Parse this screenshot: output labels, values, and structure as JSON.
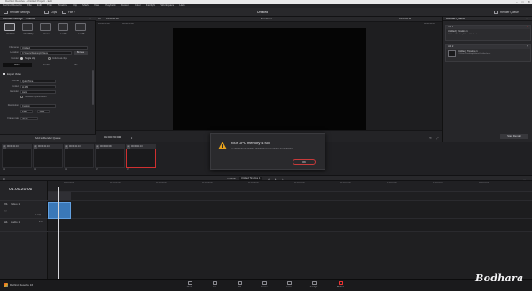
{
  "window": {
    "title": "DaVinci Resolve - Untitled Project - Edit"
  },
  "menu": [
    "DaVinci Resolve",
    "File",
    "Edit",
    "Trim",
    "Timeline",
    "Clip",
    "Mark",
    "View",
    "Playback",
    "Fusion",
    "Color",
    "Fairlight",
    "Workspace",
    "Help"
  ],
  "toolbar": {
    "render_settings": "Render Settings",
    "clips": "Clips",
    "file": "File ▾",
    "project_title": "Untitled",
    "render_queue": "Render Queue"
  },
  "render_settings": {
    "header": "Render Settings - Custom",
    "presets": [
      {
        "label": "Custom"
      },
      {
        "label": "YT 1080p"
      },
      {
        "label": "Vimeo"
      },
      {
        "label": "H.264"
      },
      {
        "label": "H.265"
      }
    ],
    "filename_label": "Filename",
    "filename_value": "Untitled",
    "location_label": "Location",
    "location_value": "C:\\Users\\Desktop\\Videos",
    "browse": "Browse",
    "render_label": "Render",
    "render_single": "Single clip",
    "render_individual": "Individual clips",
    "tabs": [
      "Video",
      "Audio",
      "File"
    ],
    "export_video": "Export Video",
    "format_label": "Format",
    "format_value": "QuickTime",
    "codec_label": "Codec",
    "codec_value": "H.264",
    "encoder_label": "Encoder",
    "encoder_value": "Auto",
    "network_opt": "Network Optimization",
    "resolution_label": "Resolution",
    "resolution_value": "Custom",
    "res_w": "1920",
    "res_h": "1080",
    "framerate_label": "Frame rate",
    "framerate_value": "29.97",
    "add_to_queue": "Add to Render Queue"
  },
  "viewer": {
    "timecode_left": "01:00:00:00",
    "timeline_name": "Timeline 1",
    "zoom": "Fit",
    "in_time": "01:00:00:00",
    "out_time": "01:00:20:08",
    "duration": "00:00:20:09",
    "current_tc": "01:00:20:08"
  },
  "render_queue": {
    "header": "Render Queue",
    "jobs": [
      {
        "id": "Job 1",
        "title": "Untitled | Timeline 1",
        "path": "C:\\Users\\Desktop\\Videos\\Untitled.mov"
      },
      {
        "id": "Job 2",
        "title": "Untitled | Timeline 1",
        "path": "C:\\Users\\Desktop\\Videos\\Untitled.mov"
      }
    ],
    "render_all": "Start Render"
  },
  "clips": [
    {
      "num": "01",
      "tc": "00:00:21:13",
      "label": "V1"
    },
    {
      "num": "02",
      "tc": "00:00:21:13",
      "label": "V1"
    },
    {
      "num": "03",
      "tc": "00:00:21:13",
      "label": "V1"
    },
    {
      "num": "04",
      "tc": "00:00:20:09",
      "label": "V1"
    },
    {
      "num": "05",
      "tc": "00:00:21:13",
      "label": "V1"
    }
  ],
  "modal": {
    "message": "Your GPU memory is full.",
    "detail": "Try reducing the timeline resolution or the number of correctors.",
    "ok": "OK"
  },
  "timeline": {
    "current_tc": "01:00:20:08",
    "timeline_label": "Timeline",
    "timeline_name": "Untitled Timeline 1",
    "video_track": "Video 1",
    "video_track_id": "V1",
    "audio_track": "Audio 1",
    "audio_track_id": "A1",
    "audio_level": "2.0",
    "clip_count": "1 Clip",
    "ruler": [
      "01:00:00:00",
      "01:00:02:00",
      "01:00:04:00",
      "01:00:06:00",
      "01:00:08:00",
      "01:00:10:00",
      "01:00:12:00",
      "01:00:14:00",
      "01:00:16:00",
      "01:00:18:00"
    ]
  },
  "pages": [
    {
      "label": "Media"
    },
    {
      "label": "Cut"
    },
    {
      "label": "Edit"
    },
    {
      "label": "Fusion"
    },
    {
      "label": "Color"
    },
    {
      "label": "Fairlight"
    },
    {
      "label": "Deliver"
    }
  ],
  "app_brand": "DaVinci Resolve 16",
  "watermark": "Bodhara",
  "colors": {
    "accent_red": "#e33a3a",
    "warning": "#e8a21c",
    "clip_blue": "#3a78b8"
  }
}
